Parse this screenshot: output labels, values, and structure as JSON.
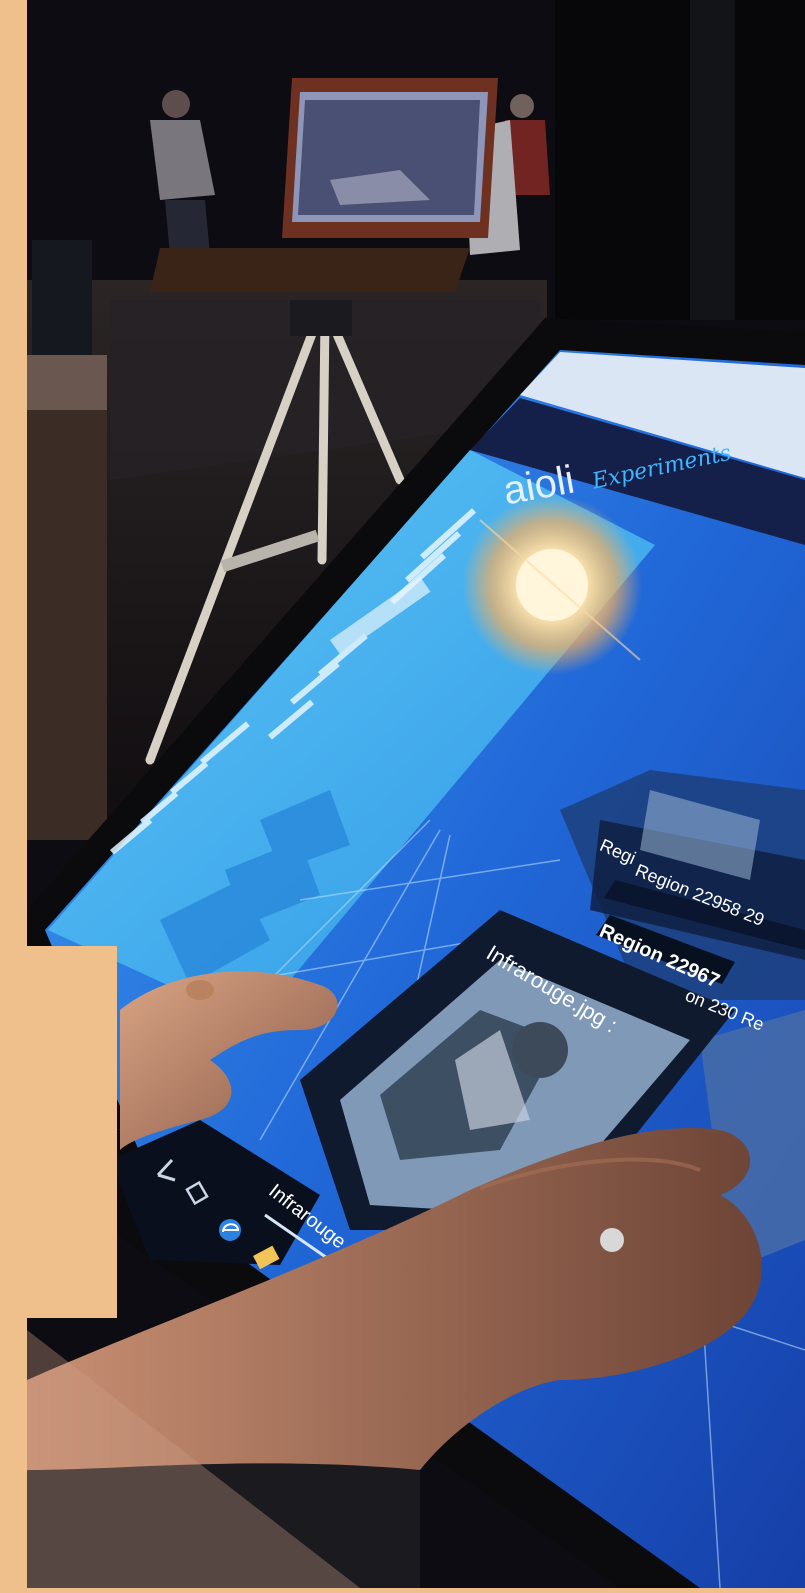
{
  "colors": {
    "frame": "#efc08c",
    "background": "#0d0c12",
    "screen": "#2a7fe0",
    "sidebar": "#45b4ee",
    "header_bar": "#14204a",
    "accent": "#ffffff"
  },
  "app": {
    "logo": "aioli",
    "logo_suffix": "Experiments"
  },
  "browser": {
    "tab_label": "Infrarouge",
    "taskbar_icons": [
      "back-arrow-icon",
      "task-view-icon",
      "edge-browser-icon",
      "file-explorer-icon"
    ]
  },
  "viewer": {
    "image_card_title": "Infrarouge.jpg :",
    "region_labels": [
      "Region 22958 29",
      "Region 22967",
      "Regi",
      "on 230 Re"
    ]
  }
}
